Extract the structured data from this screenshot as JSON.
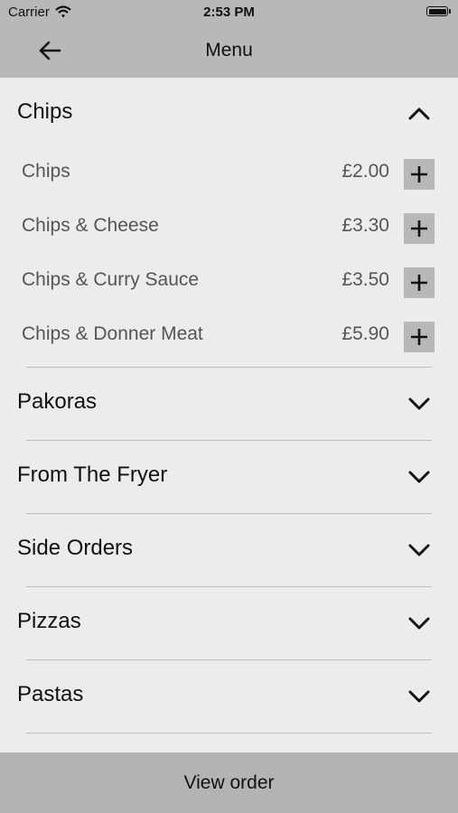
{
  "status_bar": {
    "carrier": "Carrier",
    "time": "2:53 PM",
    "wifi_icon": "wifi-icon",
    "battery_icon": "battery-icon"
  },
  "nav": {
    "title": "Menu",
    "back_icon": "back-arrow-icon"
  },
  "sections": [
    {
      "title": "Chips",
      "expanded": true,
      "items": [
        {
          "name": "Chips",
          "price": "£2.00"
        },
        {
          "name": "Chips & Cheese",
          "price": "£3.30"
        },
        {
          "name": "Chips & Curry Sauce",
          "price": "£3.50"
        },
        {
          "name": "Chips & Donner Meat",
          "price": "£5.90"
        }
      ]
    },
    {
      "title": "Pakoras",
      "expanded": false
    },
    {
      "title": "From The Fryer",
      "expanded": false
    },
    {
      "title": "Side Orders",
      "expanded": false
    },
    {
      "title": "Pizzas",
      "expanded": false
    },
    {
      "title": "Pastas",
      "expanded": false
    }
  ],
  "footer": {
    "label": "View order"
  }
}
